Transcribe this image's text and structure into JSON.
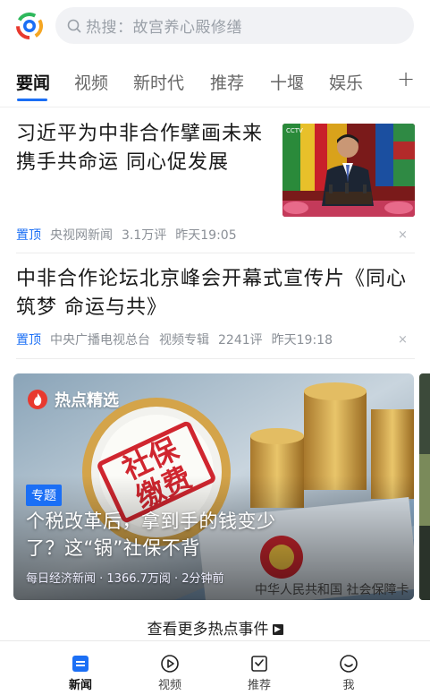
{
  "search": {
    "placeholder": "热搜：故宫养心殿修缮"
  },
  "tabs": [
    {
      "label": "要闻",
      "active": true
    },
    {
      "label": "视频",
      "active": false
    },
    {
      "label": "新时代",
      "active": false
    },
    {
      "label": "推荐",
      "active": false
    },
    {
      "label": "十堰",
      "active": false
    },
    {
      "label": "娱乐",
      "active": false
    }
  ],
  "tab_add": "+",
  "news": [
    {
      "title": "习近平为中非合作擘画未来 携手共命运 同心促发展",
      "pin": "置顶",
      "source": "央视网新闻",
      "comments": "3.1万评",
      "time": "昨天19:05",
      "close": "×"
    },
    {
      "title": "中非合作论坛北京峰会开幕式宣传片《同心筑梦 命运与共》",
      "pin": "置顶",
      "source": "中央广播电视总台",
      "tag": "视频专辑",
      "comments": "2241评",
      "time": "昨天19:18",
      "close": "×"
    }
  ],
  "hot": {
    "label": "热点精选",
    "badge": "专题",
    "title": "个税改革后，拿到手的钱变少了？这“锅”社保不背",
    "meta": "每日经济新闻 · 1366.7万阅 · 2分钟前",
    "stamp_text": "社保缴费",
    "card_text": "中华人民共和国 社会保障卡"
  },
  "more_label": "查看更多热点事件",
  "bottom_nav": [
    {
      "label": "新闻",
      "icon": "news-icon",
      "active": true
    },
    {
      "label": "视频",
      "icon": "play-icon",
      "active": false
    },
    {
      "label": "推荐",
      "icon": "recommend-icon",
      "active": false
    },
    {
      "label": "我",
      "icon": "smile-icon",
      "active": false
    }
  ],
  "colors": {
    "accent": "#1b6ff5",
    "hot_fire": "#e8392f"
  }
}
